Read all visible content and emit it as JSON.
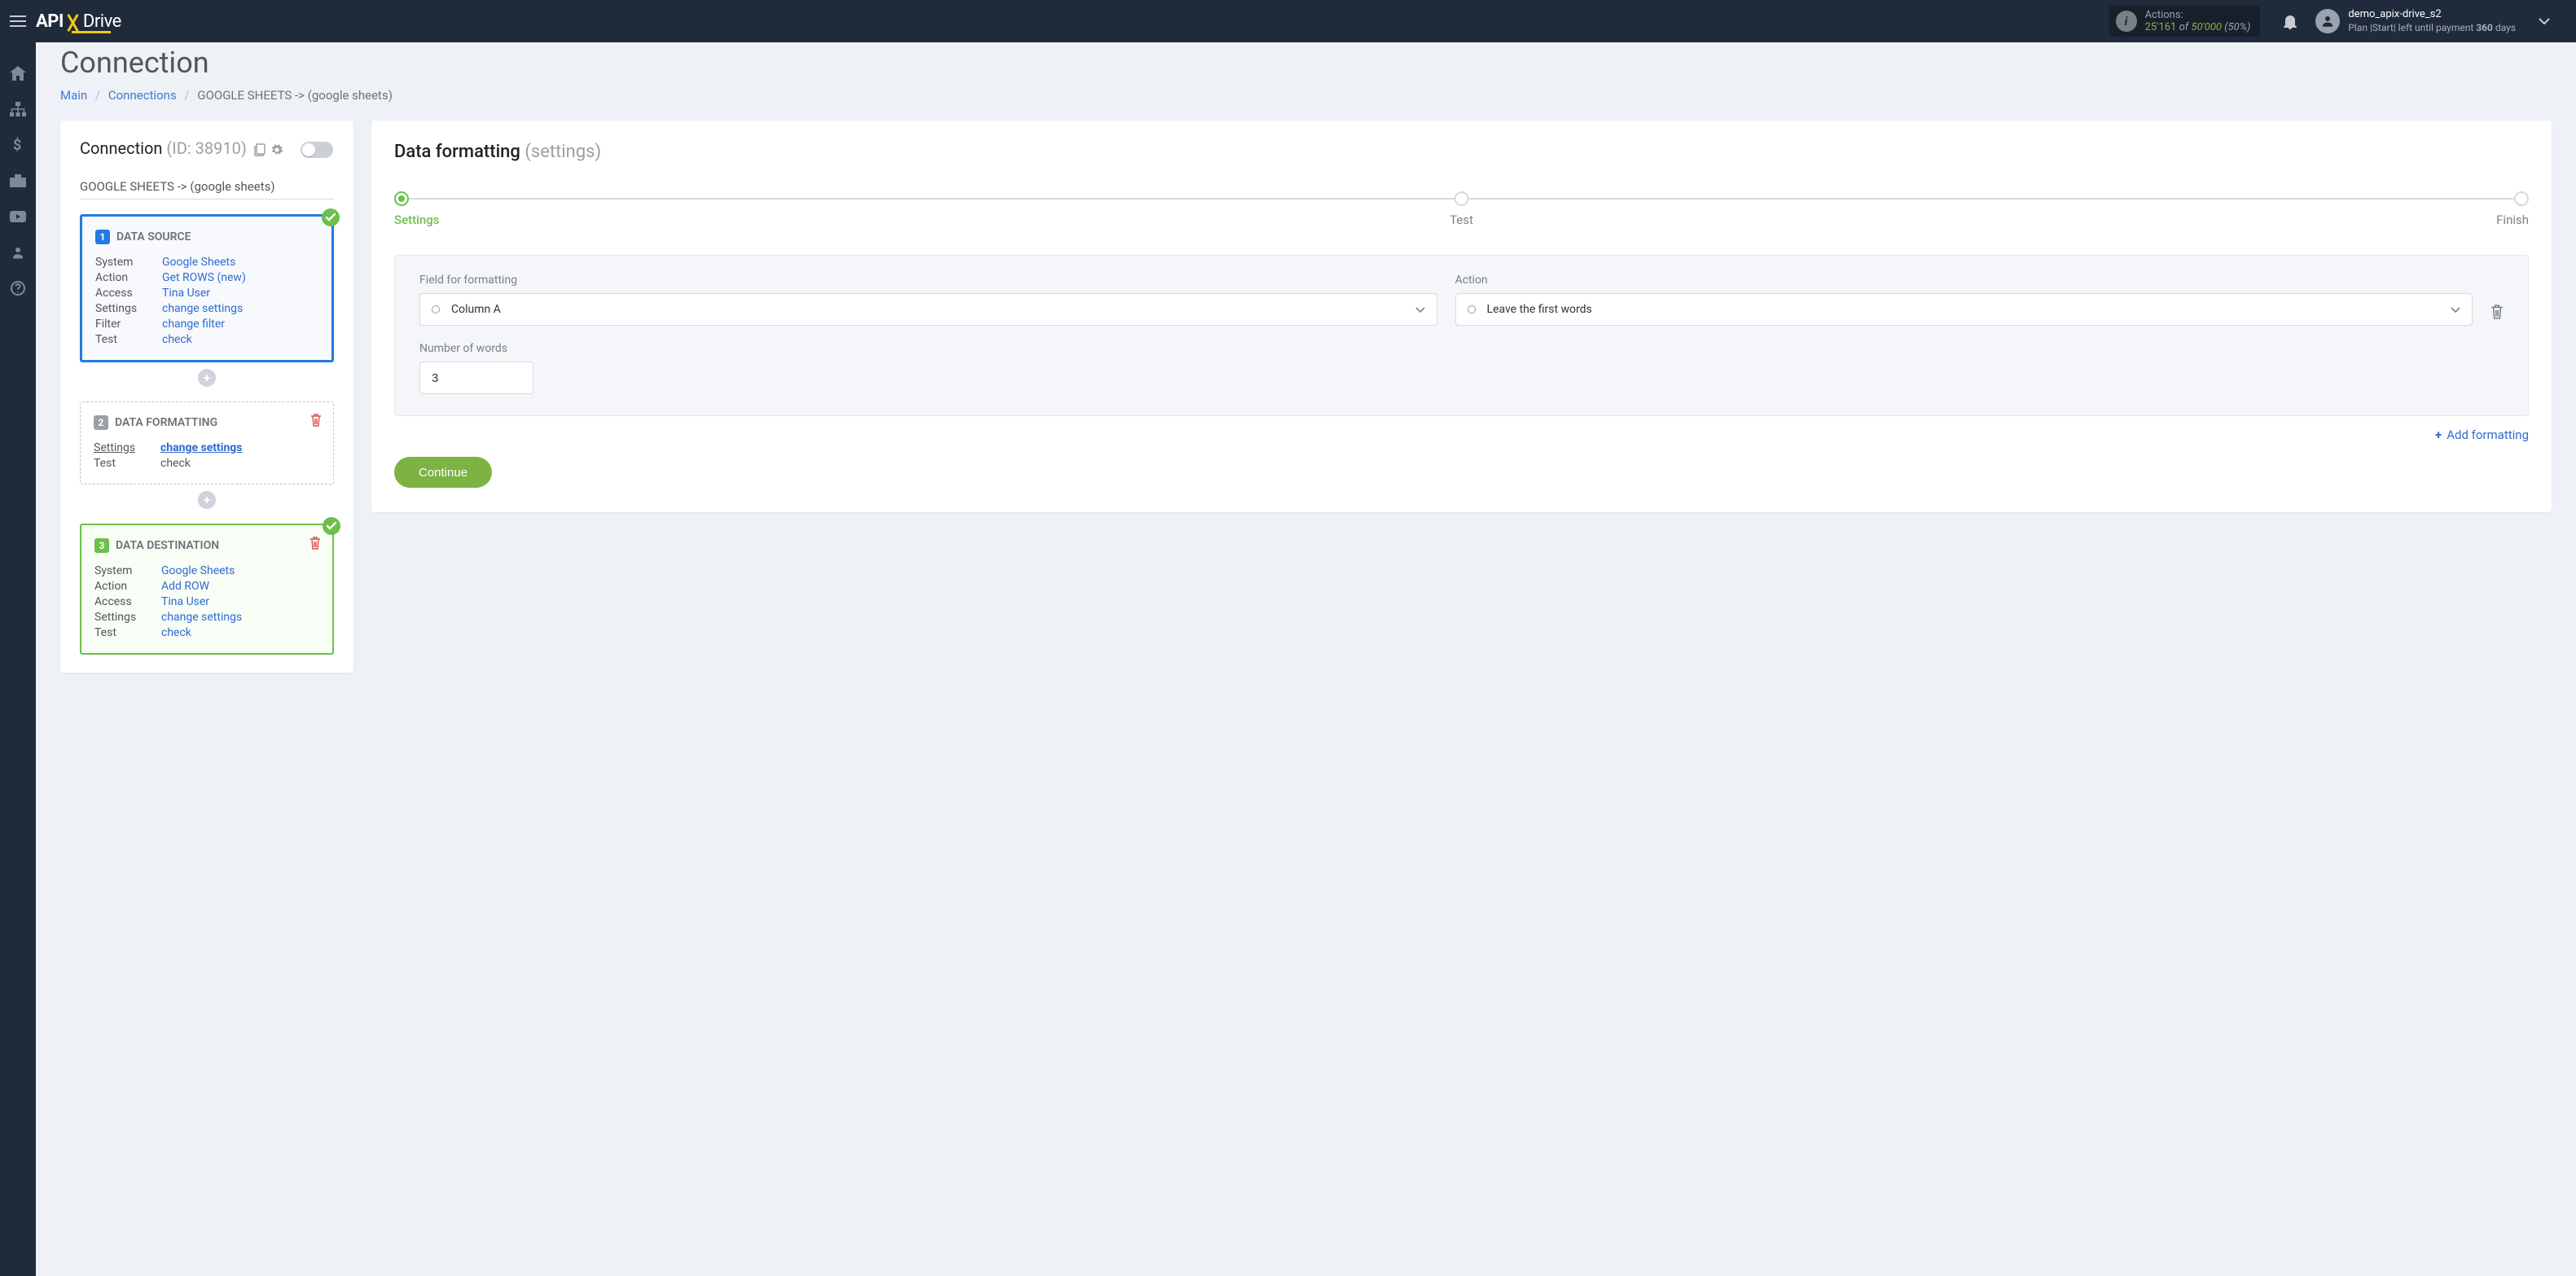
{
  "header": {
    "actions_label": "Actions:",
    "actions_used": "25'161",
    "actions_of": "of",
    "actions_total": "50'000",
    "actions_pct": "(50%)",
    "user_name": "demo_apix-drive_s2",
    "plan_prefix": "Plan |Start| left until payment ",
    "plan_days": "360",
    "plan_suffix": " days"
  },
  "page": {
    "title": "Connection"
  },
  "breadcrumbs": {
    "main": "Main",
    "connections": "Connections",
    "current": "GOOGLE SHEETS -> (google sheets)"
  },
  "left": {
    "heading": "Connection",
    "id_label": "(ID: 38910)",
    "connection_name": "GOOGLE SHEETS -> (google sheets)",
    "labels": {
      "system": "System",
      "action": "Action",
      "access": "Access",
      "settings": "Settings",
      "filter": "Filter",
      "test": "Test"
    },
    "source": {
      "title": "DATA SOURCE",
      "num": "1",
      "system": "Google Sheets",
      "action": "Get ROWS (new)",
      "access": "Tina User",
      "settings": "change settings",
      "filter": "change filter",
      "test": "check"
    },
    "formatting": {
      "title": "DATA FORMATTING",
      "num": "2",
      "settings": "change settings",
      "test": "check"
    },
    "destination": {
      "title": "DATA DESTINATION",
      "num": "3",
      "system": "Google Sheets",
      "action": "Add ROW",
      "access": "Tina User",
      "settings": "change settings",
      "test": "check"
    }
  },
  "right": {
    "title": "Data formatting",
    "subtitle": "(settings)",
    "steps": {
      "settings": "Settings",
      "test": "Test",
      "finish": "Finish"
    },
    "form": {
      "field_label": "Field for formatting",
      "field_value": "Column A",
      "action_label": "Action",
      "action_value": "Leave the first words",
      "number_label": "Number of words",
      "number_value": "3"
    },
    "add_formatting": "Add formatting",
    "continue": "Continue"
  }
}
